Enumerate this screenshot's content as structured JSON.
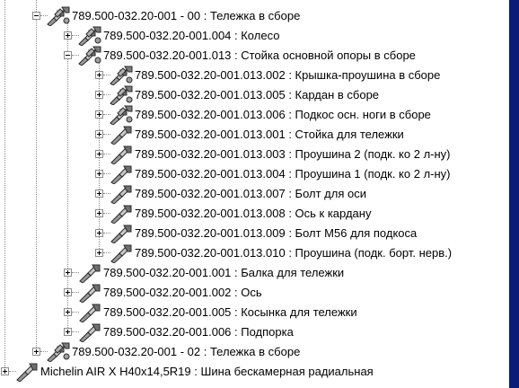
{
  "tree": {
    "items": [
      {
        "label": "789.500-032.20-001 - 00 : Тележка в сборе",
        "level": 1,
        "icon": "assembly-icon",
        "expander": "minus"
      },
      {
        "label": "789.500-032.20-001.004 : Колесо",
        "level": 2,
        "icon": "assembly-icon",
        "expander": "plus"
      },
      {
        "label": "789.500-032.20-001.013 : Стойка основной опоры в сборе",
        "level": 2,
        "icon": "assembly-icon",
        "expander": "minus"
      },
      {
        "label": "789.500-032.20-001.013.002 : Крышка-проушина в сборе",
        "level": 3,
        "icon": "assembly-icon",
        "expander": "plus"
      },
      {
        "label": "789.500-032.20-001.013.005 : Кардан в сборе",
        "level": 3,
        "icon": "assembly-icon",
        "expander": "plus"
      },
      {
        "label": "789.500-032.20-001.013.006 : Подкос осн. ноги в сборе",
        "level": 3,
        "icon": "assembly-icon",
        "expander": "plus"
      },
      {
        "label": "789.500-032.20-001.013.001 : Стойка для тележки",
        "level": 3,
        "icon": "part-icon",
        "expander": "plus"
      },
      {
        "label": "789.500-032.20-001.013.003 : Проушина 2 (подк. ко 2 л-ну)",
        "level": 3,
        "icon": "part-icon",
        "expander": "plus"
      },
      {
        "label": "789.500-032.20-001.013.004 : Проушина 1 (подк. ко 2 л-ну)",
        "level": 3,
        "icon": "part-icon",
        "expander": "plus"
      },
      {
        "label": "789.500-032.20-001.013.007 : Болт для оси",
        "level": 3,
        "icon": "part-icon",
        "expander": "plus"
      },
      {
        "label": "789.500-032.20-001.013.008 : Ось к кардану",
        "level": 3,
        "icon": "part-icon",
        "expander": "plus"
      },
      {
        "label": "789.500-032.20-001.013.009 : Болт М56 для подкоса",
        "level": 3,
        "icon": "part-icon",
        "expander": "plus"
      },
      {
        "label": "789.500-032.20-001.013.010 : Проушина (подк. борт. нерв.)",
        "level": 3,
        "icon": "part-icon",
        "expander": "plus"
      },
      {
        "label": "789.500-032.20-001.001 : Балка для тележки",
        "level": 2,
        "icon": "part-icon",
        "expander": "plus"
      },
      {
        "label": "789.500-032.20-001.002 : Ось",
        "level": 2,
        "icon": "part-icon",
        "expander": "plus"
      },
      {
        "label": "789.500-032.20-001.005 : Косынка для тележки",
        "level": 2,
        "icon": "part-icon",
        "expander": "plus"
      },
      {
        "label": "789.500-032.20-001.006 : Подпорка",
        "level": 2,
        "icon": "part-icon",
        "expander": "plus"
      },
      {
        "label": "789.500-032.20-001 - 02 : Тележка в сборе",
        "level": 1,
        "icon": "assembly-icon",
        "expander": "plus"
      },
      {
        "label": "Michelin AIR X H40x14,5R19 : Шина бескамерная радиальная",
        "level": 0,
        "icon": "part-icon",
        "expander": "plus"
      }
    ]
  },
  "colors": {
    "background": "#0b1b78",
    "panel": "#ffffff",
    "tree_lines": "#8c8c8c",
    "icon_metal": "#8a8a8a"
  }
}
